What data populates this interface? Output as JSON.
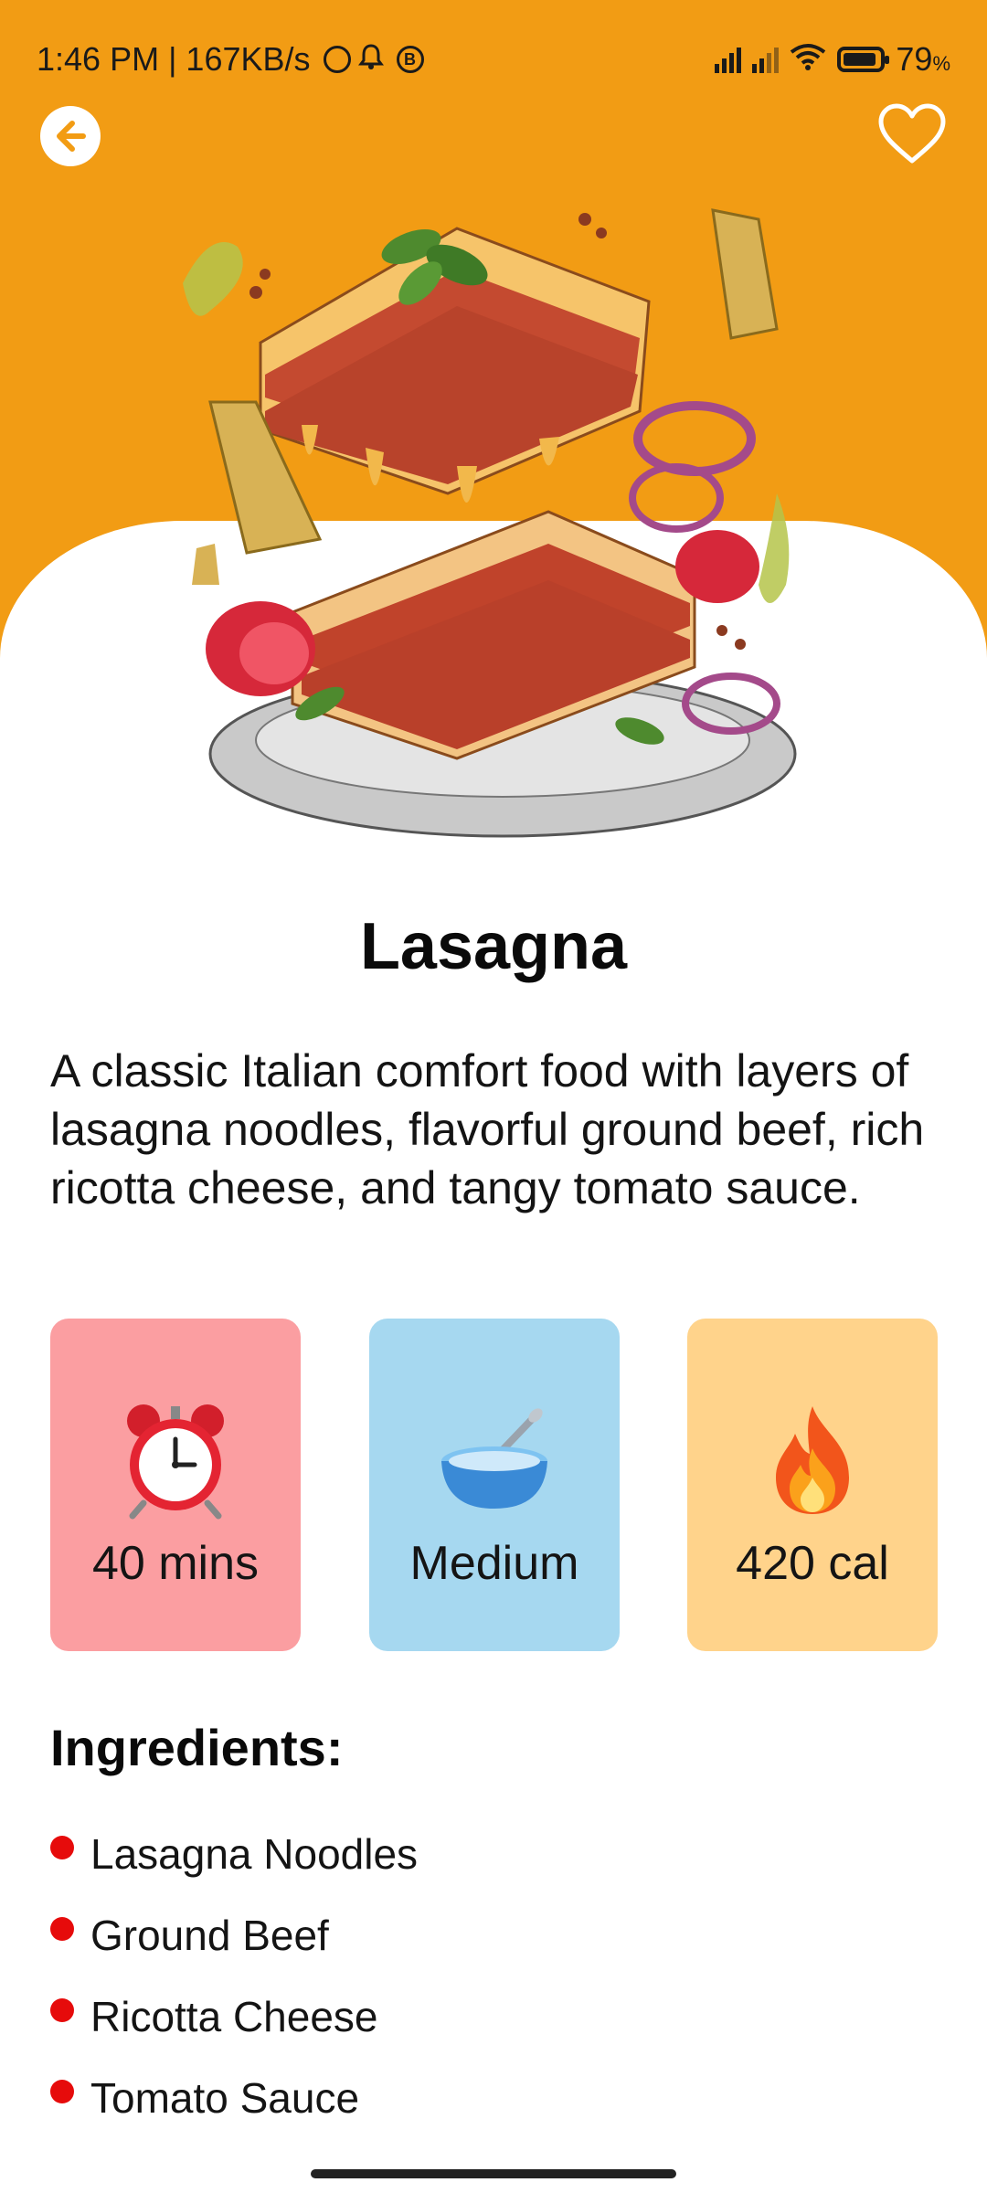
{
  "status_bar": {
    "time": "1:46 PM | 167KB/s",
    "battery": "79",
    "battery_unit": "%"
  },
  "nav": {
    "back_icon": "arrow-left-icon",
    "favorite_icon": "heart-outline-icon"
  },
  "recipe": {
    "title": "Lasagna",
    "description": "A classic Italian comfort food with layers of lasagna noodles, flavorful ground beef, rich ricotta cheese, and tangy tomato sauce."
  },
  "stats": [
    {
      "icon": "alarm-clock-icon",
      "value": "40 mins"
    },
    {
      "icon": "bowl-spoon-icon",
      "value": "Medium"
    },
    {
      "icon": "fire-icon",
      "value": "420 cal"
    }
  ],
  "ingredients": {
    "title": "Ingredients:",
    "items": [
      "Lasagna Noodles",
      "Ground Beef",
      "Ricotta Cheese",
      "Tomato Sauce"
    ]
  },
  "colors": {
    "header": "#F29C14",
    "card_time": "#FB9EA1",
    "card_level": "#A6D8F0",
    "card_cal": "#FFD38B",
    "bullet": "#E60B0B"
  }
}
